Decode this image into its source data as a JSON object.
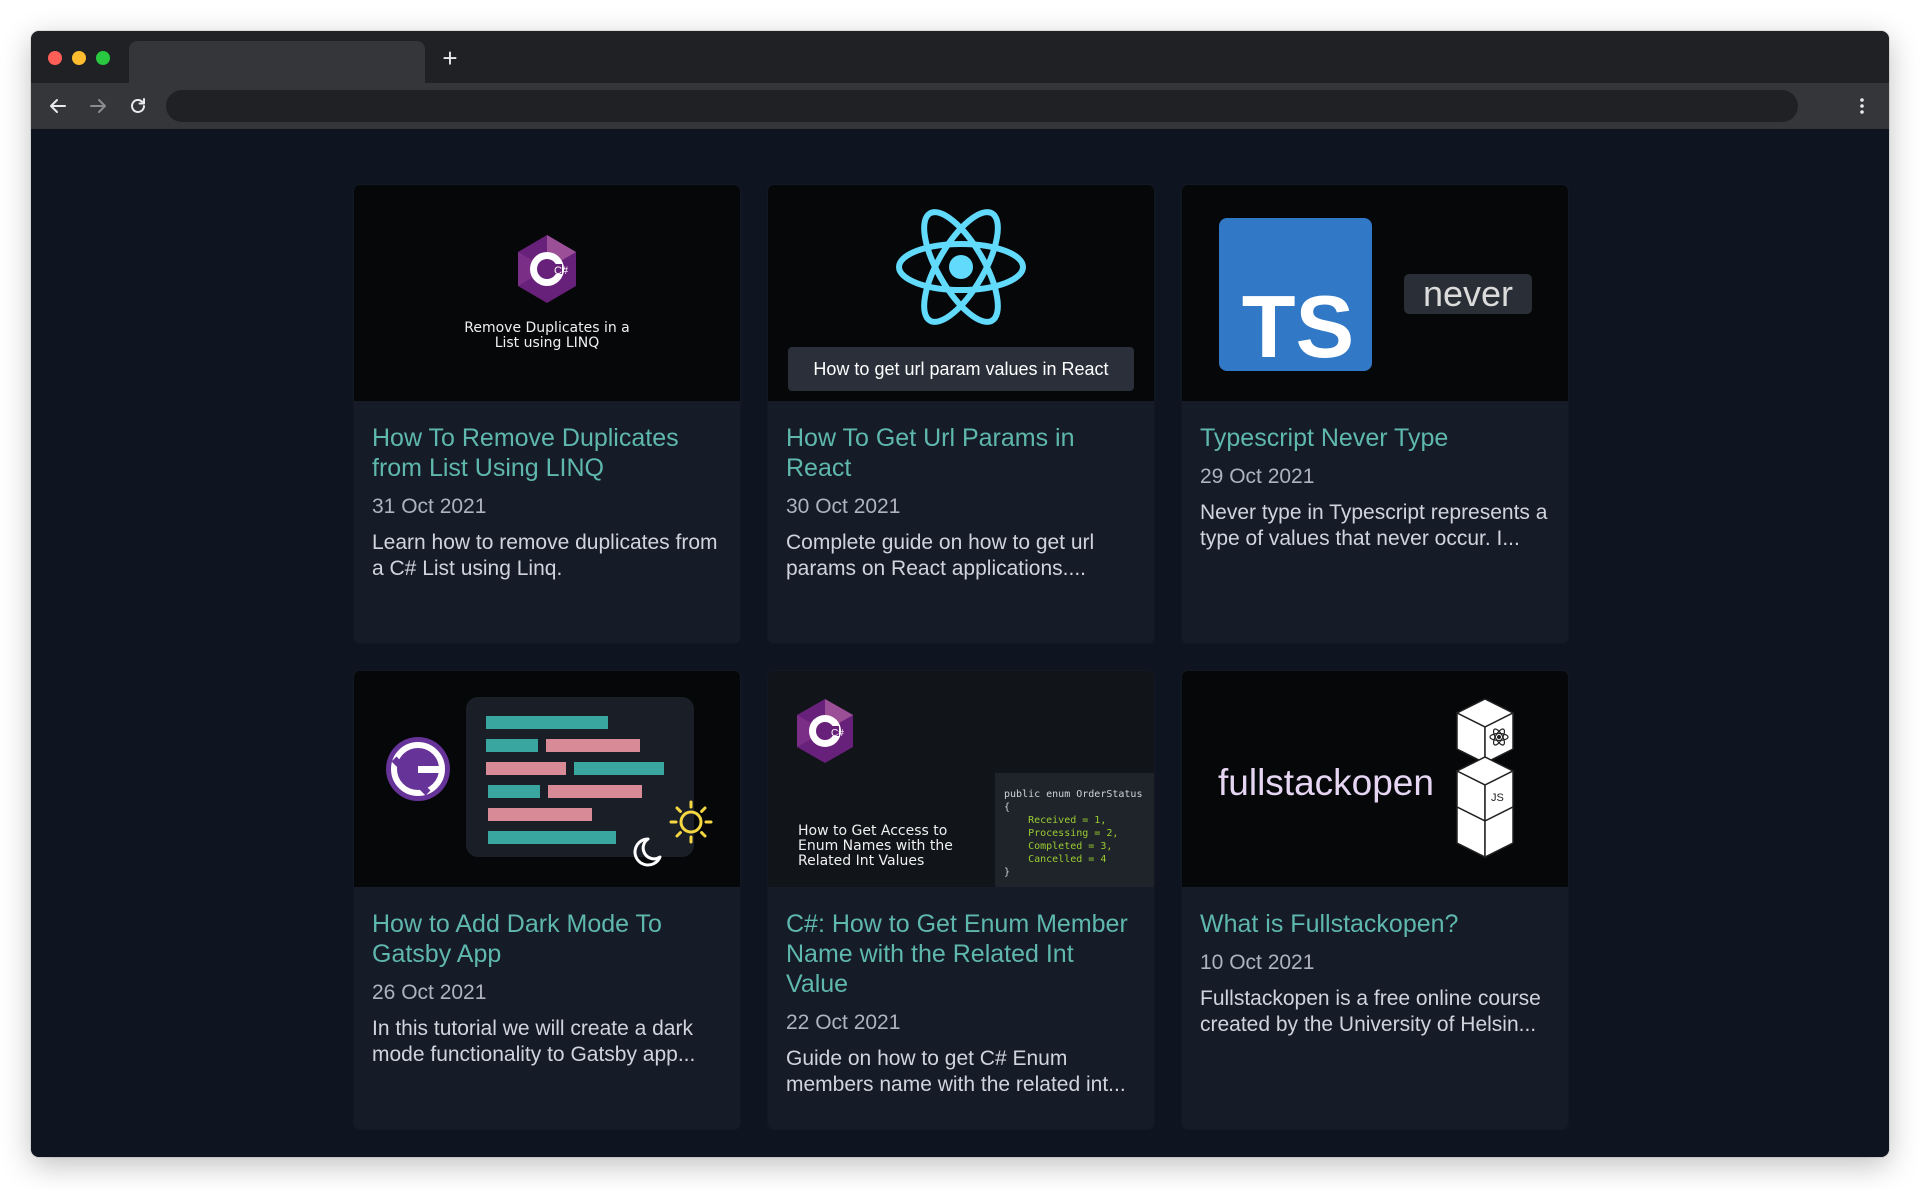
{
  "browser": {
    "new_tab_symbol": "+",
    "menu_symbol": "⋮"
  },
  "thumbs": {
    "linq": {
      "line1": "Remove Duplicates in a",
      "line2": "List using LINQ",
      "logo_text": "C#"
    },
    "react": {
      "caption": "How to get url param values in React"
    },
    "ts": {
      "logo_text": "TS",
      "badge": "never"
    },
    "enum": {
      "logo_text": "C#",
      "line1": "How to Get Access to",
      "line2": "Enum Names with the",
      "line3": "Related Int Values",
      "code": [
        "public enum OrderStatus",
        "{",
        "    Received = 1,",
        "    Processing = 2,",
        "    Completed = 3,",
        "    Cancelled = 4",
        "}"
      ]
    },
    "fso": {
      "word": "fullstackopen",
      "js": "JS"
    }
  },
  "posts": [
    {
      "title": "How To Remove Duplicates from List Using LINQ",
      "date": "31 Oct 2021",
      "excerpt": "Learn how to remove duplicates from a C# List using Linq."
    },
    {
      "title": "How To Get Url Params in React",
      "date": "30 Oct 2021",
      "excerpt": "Complete guide on how to get url params on React applications...."
    },
    {
      "title": "Typescript Never Type",
      "date": "29 Oct 2021",
      "excerpt": "Never type in Typescript represents a type of values that never occur. I..."
    },
    {
      "title": "How to Add Dark Mode To Gatsby App",
      "date": "26 Oct 2021",
      "excerpt": "In this tutorial we will create a dark mode functionality to Gatsby app..."
    },
    {
      "title": "C#: How to Get Enum Member Name with the Related Int Value",
      "date": "22 Oct 2021",
      "excerpt": "Guide on how to get C# Enum members name with the related int..."
    },
    {
      "title": "What is Fullstackopen?",
      "date": "10 Oct 2021",
      "excerpt": "Fullstackopen is a free online course created by the University of Helsin..."
    }
  ],
  "colors": {
    "title_accent": "#5fb8ae",
    "page_bg": "#0f1520",
    "card_bg": "#151b27",
    "react_blue": "#61dafb",
    "ts_blue": "#3178c6",
    "csharp_purple": "#68217a",
    "gatsby_purple": "#663399"
  }
}
